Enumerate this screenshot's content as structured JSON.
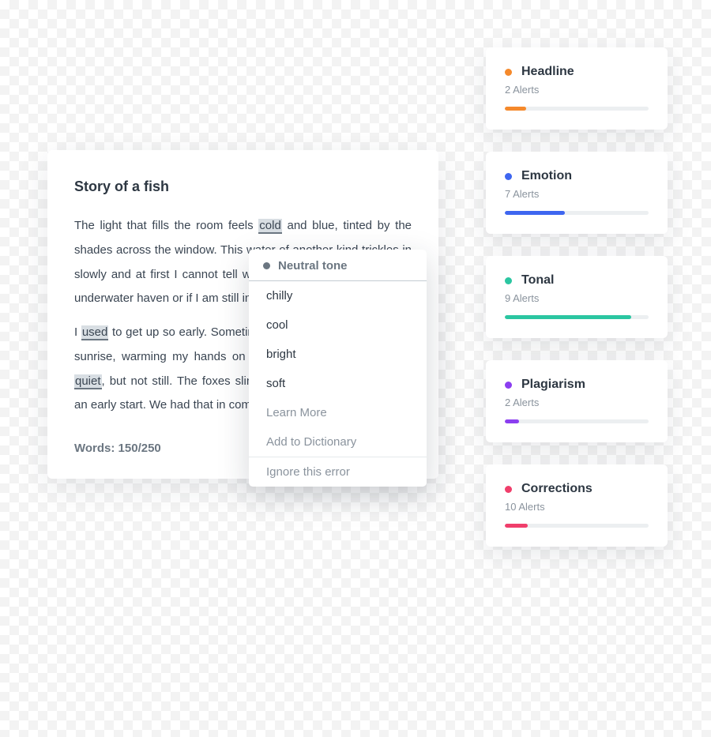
{
  "editor": {
    "title": "Story of a fish",
    "paragraph1_a": "The light that fills the room feels ",
    "paragraph1_hl1": "cold",
    "paragraph1_b": " and blue, tinted by the shades across the window. This water of another kind trickles in slowly and at first I cannot tell whether I open my eyes to this underwater haven or if I am still in.",
    "paragraph2_a": "I ",
    "paragraph2_hl1": "used",
    "paragraph2_b": " to get up so early. Sometimes I'd sit outside to watch the sunrise, warming my hands on a cup of tea. The world was ",
    "paragraph2_hl2": "quiet",
    "paragraph2_c": ", but not still. The foxes slinked about the streets, getting an early start. We had that in common, they and I.",
    "word_count": "Words: 150/250"
  },
  "popover": {
    "header": "Neutral tone",
    "suggestions": [
      "chilly",
      "cool",
      "bright",
      "soft"
    ],
    "learn_more": "Learn More",
    "add_dict": "Add to Dictionary",
    "ignore": "Ignore this error"
  },
  "alerts": [
    {
      "title": "Headline",
      "sub": "2 Alerts",
      "color": "#f5892b",
      "fill": 15
    },
    {
      "title": "Emotion",
      "sub": "7 Alerts",
      "color": "#3e66f0",
      "fill": 42
    },
    {
      "title": "Tonal",
      "sub": "9 Alerts",
      "color": "#2bc6a1",
      "fill": 88
    },
    {
      "title": "Plagiarism",
      "sub": "2 Alerts",
      "color": "#8b3ef0",
      "fill": 10
    },
    {
      "title": "Corrections",
      "sub": "10 Alerts",
      "color": "#f03e6b",
      "fill": 16
    }
  ]
}
